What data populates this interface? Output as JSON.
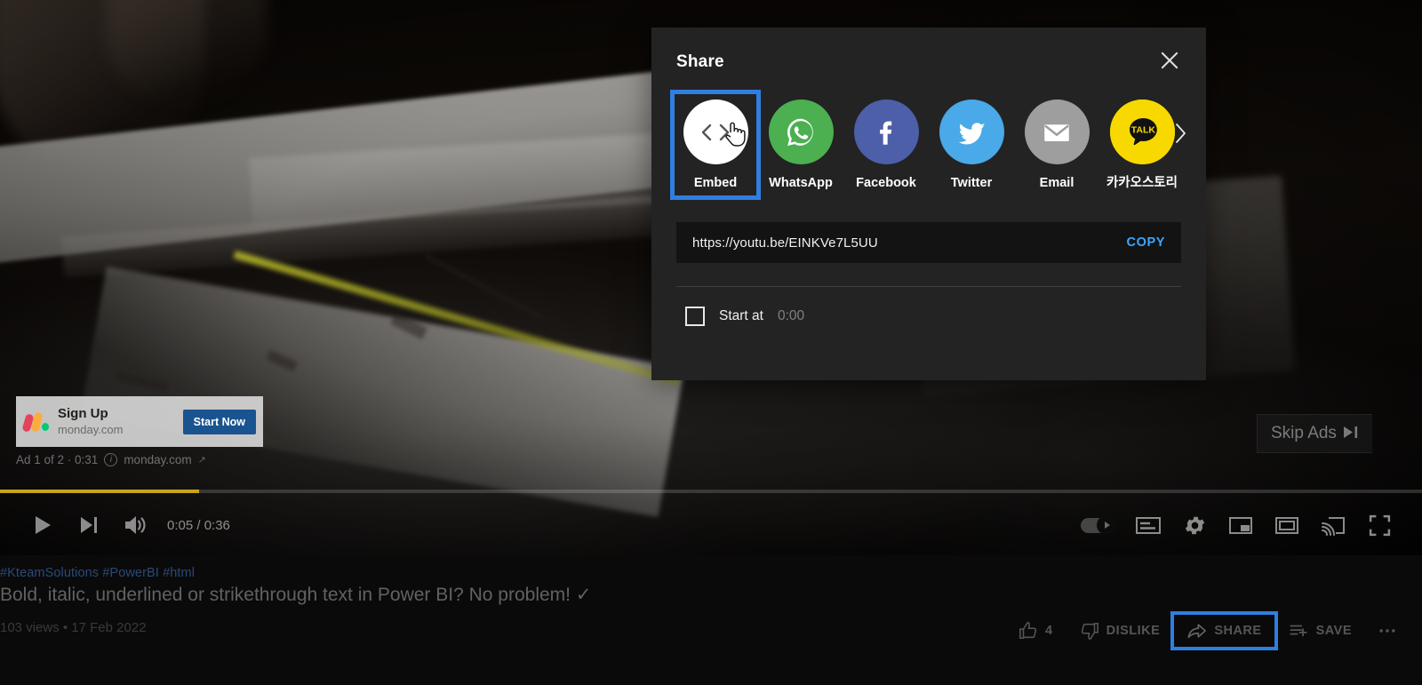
{
  "player": {
    "ad": {
      "title": "Sign Up",
      "domain": "monday.com",
      "cta_label": "Start Now",
      "meta": "Ad 1 of 2 · 0:31",
      "meta_domain": "monday.com",
      "info_glyph": "i",
      "external_glyph": "↗",
      "skip_label": "Skip Ads"
    },
    "time_display": "0:05 / 0:36",
    "progress_percent": 14,
    "progress_color": "#c8a41c",
    "controls_left": [
      {
        "name": "play-button",
        "icon": "play-icon"
      },
      {
        "name": "next-video-button",
        "icon": "next-track-icon"
      },
      {
        "name": "volume-button",
        "icon": "volume-icon"
      }
    ],
    "controls_right": [
      {
        "name": "autoplay-toggle",
        "icon": "autoplay-toggle-icon"
      },
      {
        "name": "subtitles-button",
        "icon": "closed-captions-icon"
      },
      {
        "name": "settings-button",
        "icon": "gear-icon"
      },
      {
        "name": "miniplayer-button",
        "icon": "miniplayer-icon"
      },
      {
        "name": "theater-mode-button",
        "icon": "theater-mode-icon"
      },
      {
        "name": "cast-button",
        "icon": "cast-icon"
      },
      {
        "name": "fullscreen-button",
        "icon": "fullscreen-icon"
      }
    ]
  },
  "video_meta": {
    "hashtags": [
      "#KteamSolutions",
      "#PowerBI",
      "#html"
    ],
    "title": "Bold, italic, underlined or strikethrough text in Power BI? No problem! ✓",
    "views": "103 views",
    "separator": "•",
    "date": "17 Feb 2022",
    "view_line": "103 views • 17 Feb 2022"
  },
  "actions": {
    "like_count": "4",
    "dislike_label": "DISLIKE",
    "share_label": "SHARE",
    "save_label": "SAVE",
    "more_label": "…",
    "highlight_color": "#2f7fe0"
  },
  "share_dialog": {
    "title": "Share",
    "close_label": "×",
    "targets": [
      {
        "label": "Embed",
        "icon": "code-brackets-icon",
        "bg": "#ffffff",
        "selected": true
      },
      {
        "label": "WhatsApp",
        "icon": "whatsapp-icon",
        "bg": "#4caf50",
        "selected": false
      },
      {
        "label": "Facebook",
        "icon": "facebook-icon",
        "bg": "#4c5fa8",
        "selected": false
      },
      {
        "label": "Twitter",
        "icon": "twitter-icon",
        "bg": "#4aa9e8",
        "selected": false
      },
      {
        "label": "Email",
        "icon": "email-icon",
        "bg": "#9e9e9e",
        "selected": false
      },
      {
        "label": "카카오스토리",
        "icon": "kakaotalk-icon",
        "bg": "#f7d900",
        "selected": false
      }
    ],
    "next_arrow": "›",
    "url": "https://youtu.be/EINKVe7L5UU",
    "copy_label": "COPY",
    "start_at_label": "Start at",
    "start_at_time": "0:00",
    "start_at_checked": false,
    "selection_color": "#2f7fe0"
  }
}
